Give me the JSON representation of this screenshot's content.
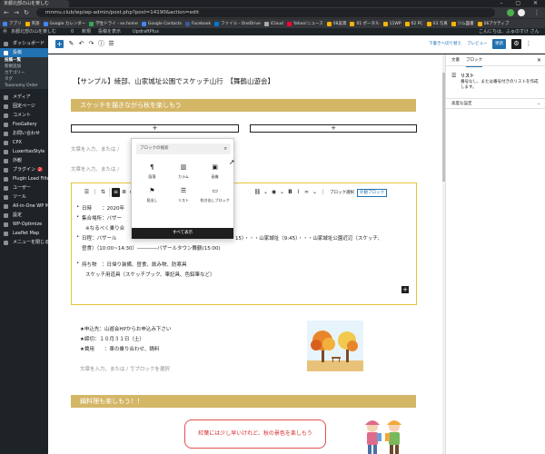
{
  "browser": {
    "tab_title": "京都北部の山を楽しむ",
    "url": "mnmu.club/wp/wp-admin/post.php?post=14190&action=edit",
    "bookmarks": [
      {
        "label": "アプリ",
        "color": "#4285f4"
      },
      {
        "label": "英語",
        "color": "#f4b400"
      },
      {
        "label": "Google カレンダー",
        "color": "#4285f4"
      },
      {
        "label": "学生ドライ - ex.home",
        "color": "#34a853"
      },
      {
        "label": "Google Contacts",
        "color": "#4285f4"
      },
      {
        "label": "Facebook",
        "color": "#3b5998"
      },
      {
        "label": "ファイル - OneDrive",
        "color": "#0078d4"
      },
      {
        "label": "iCloud",
        "color": "#aaaaaa"
      },
      {
        "label": "Yahoo!ニュース",
        "color": "#ff0033"
      },
      {
        "label": "08美景",
        "color": "#f4b400"
      },
      {
        "label": "01 ポータル",
        "color": "#f4b400"
      },
      {
        "label": "11WP",
        "color": "#f4b400"
      },
      {
        "label": "02 PC",
        "color": "#f4b400"
      },
      {
        "label": "03 写真",
        "color": "#f4b400"
      },
      {
        "label": "ツム図書",
        "color": "#f4b400"
      },
      {
        "label": "06アクティブ",
        "color": "#f4b400"
      }
    ]
  },
  "adminbar": {
    "site": "京都北部の山を楽しむ",
    "items": [
      "0",
      "新規",
      "投稿を表示",
      "UpdraftPlus"
    ],
    "greeting": "こんにちは、ふゅのすけ さん"
  },
  "sidebar": {
    "items": [
      {
        "label": "ダッシュボード",
        "active": false
      },
      {
        "label": "投稿",
        "active": true
      }
    ],
    "subitems": [
      {
        "label": "投稿一覧",
        "current": true
      },
      {
        "label": "新規追加",
        "current": false
      },
      {
        "label": "カテゴリー",
        "current": false
      },
      {
        "label": "タグ",
        "current": false
      },
      {
        "label": "Taxonomy Order",
        "current": false
      }
    ],
    "more_items": [
      {
        "label": "メディア"
      },
      {
        "label": "固定ページ"
      },
      {
        "label": "コメント"
      },
      {
        "label": "FooGallery"
      },
      {
        "label": "お問い合わせ"
      },
      {
        "label": "CPX"
      },
      {
        "label": "LuxeritasStyle"
      },
      {
        "label": "外観"
      },
      {
        "label": "プラグイン",
        "badge": "2"
      },
      {
        "label": "Plugin Load Filter"
      },
      {
        "label": "ユーザー"
      },
      {
        "label": "ツール"
      },
      {
        "label": "All-in-One WP Migration"
      },
      {
        "label": "設定"
      },
      {
        "label": "WP-Optimize"
      },
      {
        "label": "Leaflet Map"
      },
      {
        "label": "メニューを閉じる"
      }
    ]
  },
  "editor_toolbar": {
    "draft_label": "下書きへ切り替え",
    "preview_label": "プレビュー",
    "update_label": "更新"
  },
  "post": {
    "title": "【サンプル】綾部、山家城址公園でスケッチ山行　【舞鶴山遊会】",
    "heading1": "スケッチを描きながら秋を楽しもう",
    "heading2": "鍋料理も楽しもう！！",
    "placeholder": "文章を入力、または / でブロックを選択",
    "placeholder_short1": "文章を入力、または /",
    "placeholder_short2": "文章を入力、または /",
    "list_lines": [
      {
        "text": "日時　　：2020年",
        "bullet": true
      },
      {
        "text": "集合場所：バザー",
        "bullet": true
      },
      {
        "text": "※なるべく乗り合",
        "bullet": false
      },
      {
        "text": "日程：バザール",
        "bullet": true
      },
      {
        "text": "昼食）（10:00~14:30）――――バザールタウン舞鶴(15:00)",
        "bullet": false
      },
      {
        "text": "持ち物　：日帰り装備、昼食、飲み物、防寒具",
        "bullet": true
      },
      {
        "text": "スケッチ用道具（スケッチブック、筆記具、色鉛筆など）",
        "bullet": false
      }
    ],
    "list_line3_tail": "15）・・・山家城址（9:45）・・・山家城址公園近辺（スケッチ、",
    "info_lines": [
      "★申込先：山遊会HPからお申込み下さい",
      "★締切：１０月３１日（土）",
      "★費用　　：車の乗り合わせ、鍋料"
    ],
    "speech_text": "紅葉には少し早いけれど、秋の景色を楽しもう"
  },
  "block_toolbar": {
    "tool_label": "ブロック選択",
    "style_label": "外観ブロック"
  },
  "inserter": {
    "search_placeholder": "ブロックの検索",
    "blocks": [
      {
        "label": "段落",
        "icon": "¶"
      },
      {
        "label": "カラム",
        "icon": "▥"
      },
      {
        "label": "画像",
        "icon": "▣"
      },
      {
        "label": "見出し",
        "icon": "⚑"
      },
      {
        "label": "リスト",
        "icon": "☰"
      },
      {
        "label": "吹き出しブロック",
        "icon": "▭"
      }
    ],
    "browse_all": "すべて表示"
  },
  "settings_panel": {
    "tab_document": "文書",
    "tab_block": "ブロック",
    "block_name": "リスト",
    "block_desc": "番号なし、または番号付きのリストを作成します。",
    "advanced": "高度な設定"
  }
}
